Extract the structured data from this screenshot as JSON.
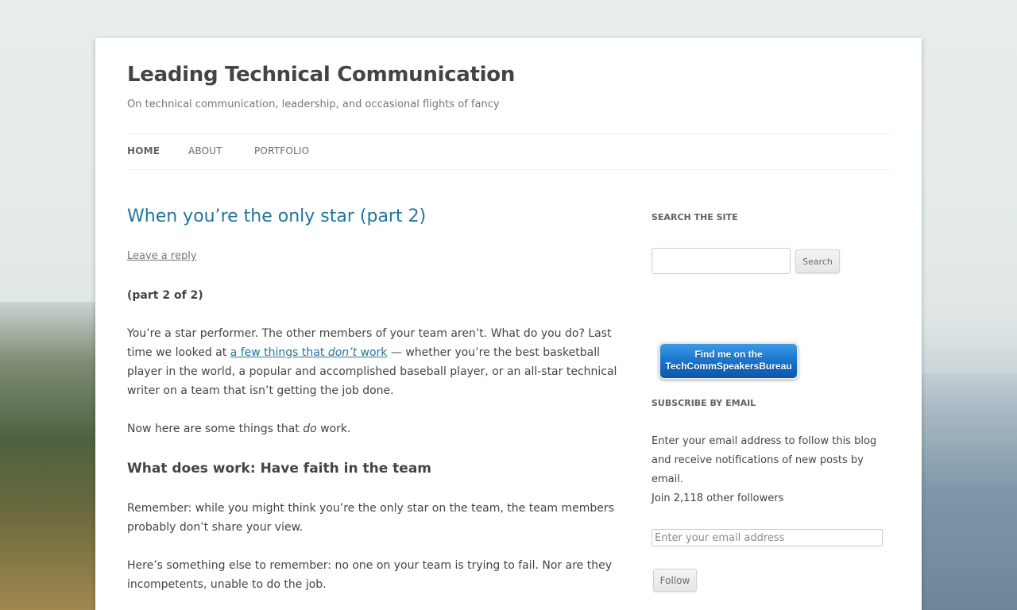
{
  "site": {
    "title": "Leading Technical Communication",
    "description": "On technical communication, leadership, and occasional flights of fancy"
  },
  "nav": {
    "items": [
      {
        "label": "Home",
        "current": true
      },
      {
        "label": "About",
        "current": false
      },
      {
        "label": "Portfolio",
        "current": false
      }
    ]
  },
  "post": {
    "title": "When you’re the only star (part 2)",
    "reply_link": "Leave a reply",
    "part": "(part 2 of 2)",
    "p1_before": "You’re a star performer. The other members of your team aren’t. What do you do? Last time we looked at ",
    "p1_link_before": "a few things that ",
    "p1_link_em": "don’t",
    "p1_link_after": " work",
    "p1_after": " — whether you’re the best basketball player in the world, a popular and accomplished baseball player, or an all-star technical writer on a team that isn’t getting the job done.",
    "p2_before": "Now here are some things that ",
    "p2_em": "do",
    "p2_after": " work.",
    "heading": "What does work: Have faith in the team",
    "p3": "Remember: while you might think you’re the only star on the team, the team members probably don’t share your view.",
    "p4": "Here’s something else to remember: no one on your team is trying to fail. Nor are they incompetents, unable to do the job."
  },
  "sidebar": {
    "search_title": "Search the site",
    "search_button": "Search",
    "badge_line1": "Find me on the",
    "badge_line2": "TechCommSpeakersBureau",
    "subscribe_title": "Subscribe by email",
    "subscribe_text": "Enter your email address to follow this blog and receive notifications of new posts by email.",
    "followers_text": "Join 2,118 other followers",
    "email_placeholder": "Enter your email address",
    "follow_button": "Follow"
  },
  "colors": {
    "link": "#21759b",
    "text": "#444444",
    "badge": "#1670c9"
  }
}
